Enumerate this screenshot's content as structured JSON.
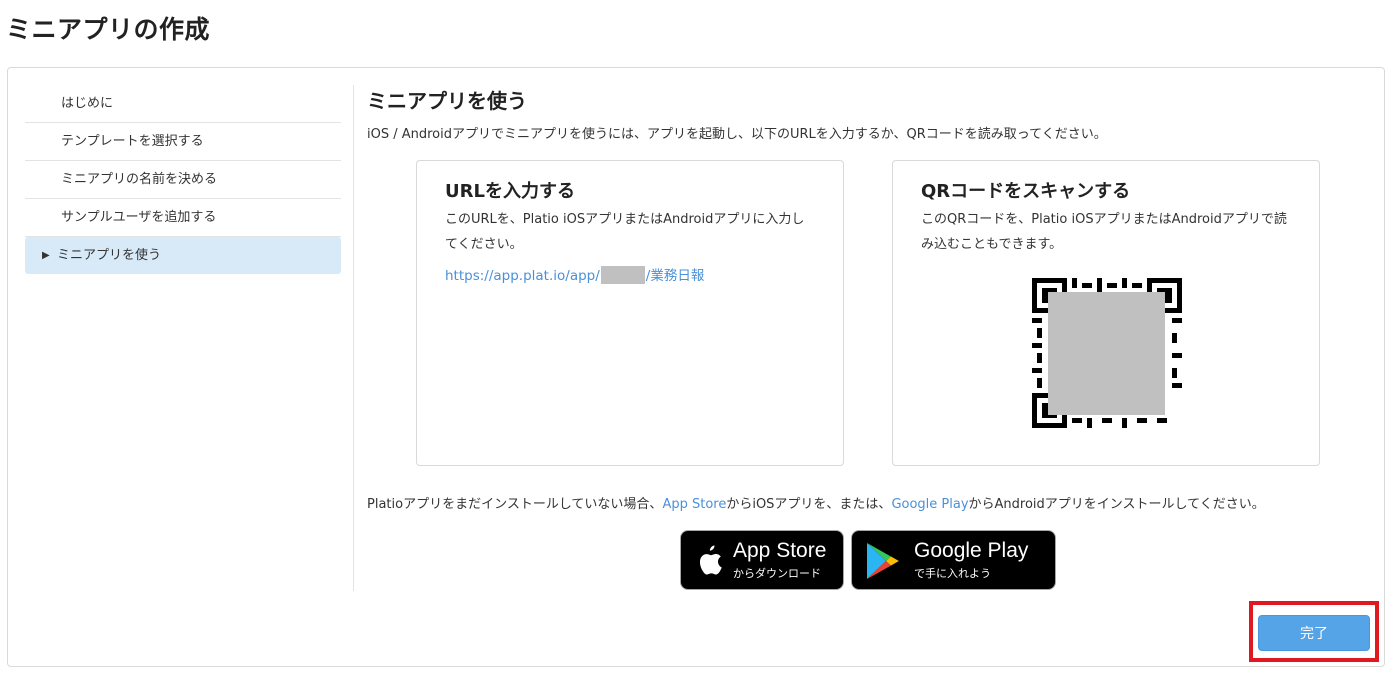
{
  "page": {
    "title": "ミニアプリの作成"
  },
  "sidebar": {
    "items": [
      {
        "label": "はじめに"
      },
      {
        "label": "テンプレートを選択する"
      },
      {
        "label": "ミニアプリの名前を決める"
      },
      {
        "label": "サンプルユーザを追加する"
      },
      {
        "label": "ミニアプリを使う",
        "active": true
      }
    ],
    "active_marker": "▶"
  },
  "main": {
    "title": "ミニアプリを使う",
    "description": "iOS / Androidアプリでミニアプリを使うには、アプリを起動し、以下のURLを入力するか、QRコードを読み取ってください。",
    "url_card": {
      "title": "URLを入力する",
      "description": "このURLを、Platio iOSアプリまたはAndroidアプリに入力してください。",
      "url_prefix": "https://app.plat.io/app/",
      "url_suffix": "/業務日報"
    },
    "qr_card": {
      "title": "QRコードをスキャンする",
      "description": "このQRコードを、Platio iOSアプリまたはAndroidアプリで読み込むこともできます。"
    },
    "install": {
      "text_before": "Platioアプリをまだインストールしていない場合、",
      "app_store_link": "App Store",
      "text_middle1": "からiOSアプリを、または、",
      "google_play_link": "Google Play",
      "text_after": "からAndroidアプリをインストールしてください。"
    },
    "badges": {
      "apple": {
        "big": "App Store",
        "small": "からダウンロード",
        "icon": "apple-icon"
      },
      "google": {
        "big": "Google Play",
        "small": "で手に入れよう",
        "icon": "google-play-icon"
      }
    }
  },
  "footer": {
    "done_label": "完了",
    "highlight_color": "#e0181f"
  },
  "colors": {
    "accent": "#56a4e8",
    "link": "#4a90d9",
    "active_bg": "#d8eaf8"
  }
}
